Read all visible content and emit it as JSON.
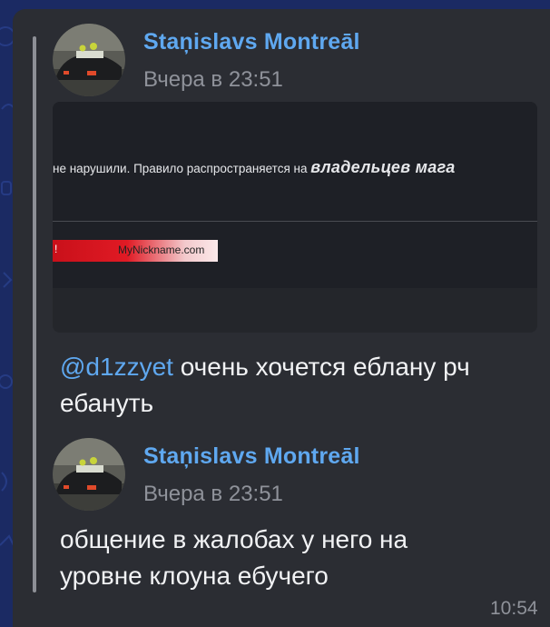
{
  "messages": [
    {
      "author": "Staņislavs Montreāl",
      "time": "Вчера в 23:51",
      "embed": {
        "text_plain": "не нарушили. Правило распространяется на ",
        "text_bold": "владельцев мага",
        "nickname": "MyNickname.com",
        "nick_mark": "!"
      },
      "mention": "@d1zzyet",
      "text_line1": " очень хочется еблану рч",
      "text_line2": "ебануть"
    },
    {
      "author": "Staņislavs Montreāl",
      "time": "Вчера в 23:51",
      "text_line1": "общение в жалобах у него на",
      "text_line2": "уровне клоуна ебучего"
    }
  ],
  "message_time": "10:54",
  "colors": {
    "background": "#1b2a63",
    "bubble": "#2b2d33",
    "name_link": "#5fa8f0",
    "meta": "#8f929a"
  },
  "icons": [
    "avatar-car-photo",
    "chat-doodle-wallpaper"
  ]
}
